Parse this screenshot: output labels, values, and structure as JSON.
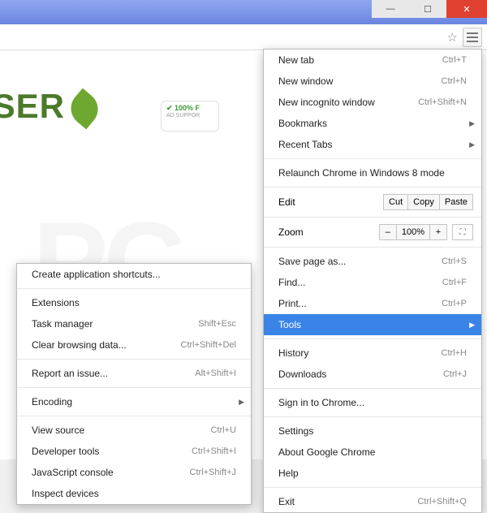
{
  "window": {
    "min": "—",
    "max": "☐",
    "close": "✕"
  },
  "bg": {
    "wordFrag": "WSER",
    "badgeTop": "✔ 100% F",
    "badgeSub": "AD SUPPOR"
  },
  "menu": {
    "newTab": {
      "label": "New tab",
      "shortcut": "Ctrl+T"
    },
    "newWindow": {
      "label": "New window",
      "shortcut": "Ctrl+N"
    },
    "incognito": {
      "label": "New incognito window",
      "shortcut": "Ctrl+Shift+N"
    },
    "bookmarks": {
      "label": "Bookmarks"
    },
    "recentTabs": {
      "label": "Recent Tabs"
    },
    "relaunch": {
      "label": "Relaunch Chrome in Windows 8 mode"
    },
    "edit": {
      "label": "Edit",
      "cut": "Cut",
      "copy": "Copy",
      "paste": "Paste"
    },
    "zoom": {
      "label": "Zoom",
      "minus": "–",
      "value": "100%",
      "plus": "+"
    },
    "saveAs": {
      "label": "Save page as...",
      "shortcut": "Ctrl+S"
    },
    "find": {
      "label": "Find...",
      "shortcut": "Ctrl+F"
    },
    "print": {
      "label": "Print...",
      "shortcut": "Ctrl+P"
    },
    "tools": {
      "label": "Tools"
    },
    "history": {
      "label": "History",
      "shortcut": "Ctrl+H"
    },
    "downloads": {
      "label": "Downloads",
      "shortcut": "Ctrl+J"
    },
    "signIn": {
      "label": "Sign in to Chrome..."
    },
    "settings": {
      "label": "Settings"
    },
    "about": {
      "label": "About Google Chrome"
    },
    "help": {
      "label": "Help"
    },
    "exit": {
      "label": "Exit",
      "shortcut": "Ctrl+Shift+Q"
    }
  },
  "sub": {
    "createShortcuts": {
      "label": "Create application shortcuts..."
    },
    "extensions": {
      "label": "Extensions"
    },
    "taskManager": {
      "label": "Task manager",
      "shortcut": "Shift+Esc"
    },
    "clearData": {
      "label": "Clear browsing data...",
      "shortcut": "Ctrl+Shift+Del"
    },
    "report": {
      "label": "Report an issue...",
      "shortcut": "Alt+Shift+I"
    },
    "encoding": {
      "label": "Encoding"
    },
    "viewSource": {
      "label": "View source",
      "shortcut": "Ctrl+U"
    },
    "devTools": {
      "label": "Developer tools",
      "shortcut": "Ctrl+Shift+I"
    },
    "jsConsole": {
      "label": "JavaScript console",
      "shortcut": "Ctrl+Shift+J"
    },
    "inspect": {
      "label": "Inspect devices"
    }
  }
}
